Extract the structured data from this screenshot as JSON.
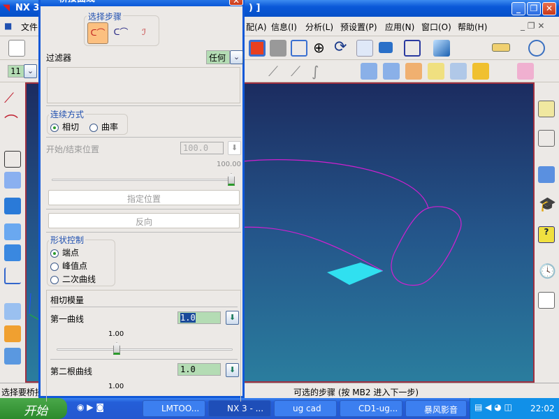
{
  "app": {
    "title": "NX 3",
    "title_suffix": ")  ]"
  },
  "menu": {
    "items": [
      "文件",
      "配(A)",
      "信息(I)",
      "分析(L)",
      "预设置(P)",
      "应用(N)",
      "窗口(O)",
      "帮助(H)"
    ]
  },
  "toolbar": {
    "layer_value": "11"
  },
  "dialog": {
    "title": "桥接曲线",
    "steps_label": "选择步骤",
    "filter_label": "过滤器",
    "filter_value": "任何",
    "continuity": {
      "label": "连续方式",
      "options": [
        "相切",
        "曲率"
      ],
      "selected": "相切"
    },
    "position": {
      "label": "开始/结束位置",
      "value": "100.0",
      "slider_label": "100.00",
      "slider_fraction": 1.0
    },
    "specify_button": "指定位置",
    "reverse_button": "反向",
    "shape": {
      "label": "形状控制",
      "options": [
        "端点",
        "峰值点",
        "二次曲线"
      ],
      "selected": "端点"
    },
    "tangent": {
      "label": "相切模量",
      "first": {
        "label": "第一曲线",
        "value": "1.0",
        "slider_label": "1.00"
      },
      "second": {
        "label": "第二根曲线",
        "value": "1.0",
        "slider_label": "1.00"
      }
    }
  },
  "status": {
    "left": "选择要桥接",
    "right": "可选的步骤 (按 MB2 进入下一步)"
  },
  "taskbar": {
    "start": "开始",
    "tasks": [
      "LMTOO...",
      "NX 3 - ...",
      "ug cad",
      "CD1-ug...",
      "暴风影音"
    ],
    "clock": "22:02"
  },
  "colors": {
    "curve": "#d020d0",
    "surface": "#30e0f0",
    "accent": "#0a58d8"
  }
}
